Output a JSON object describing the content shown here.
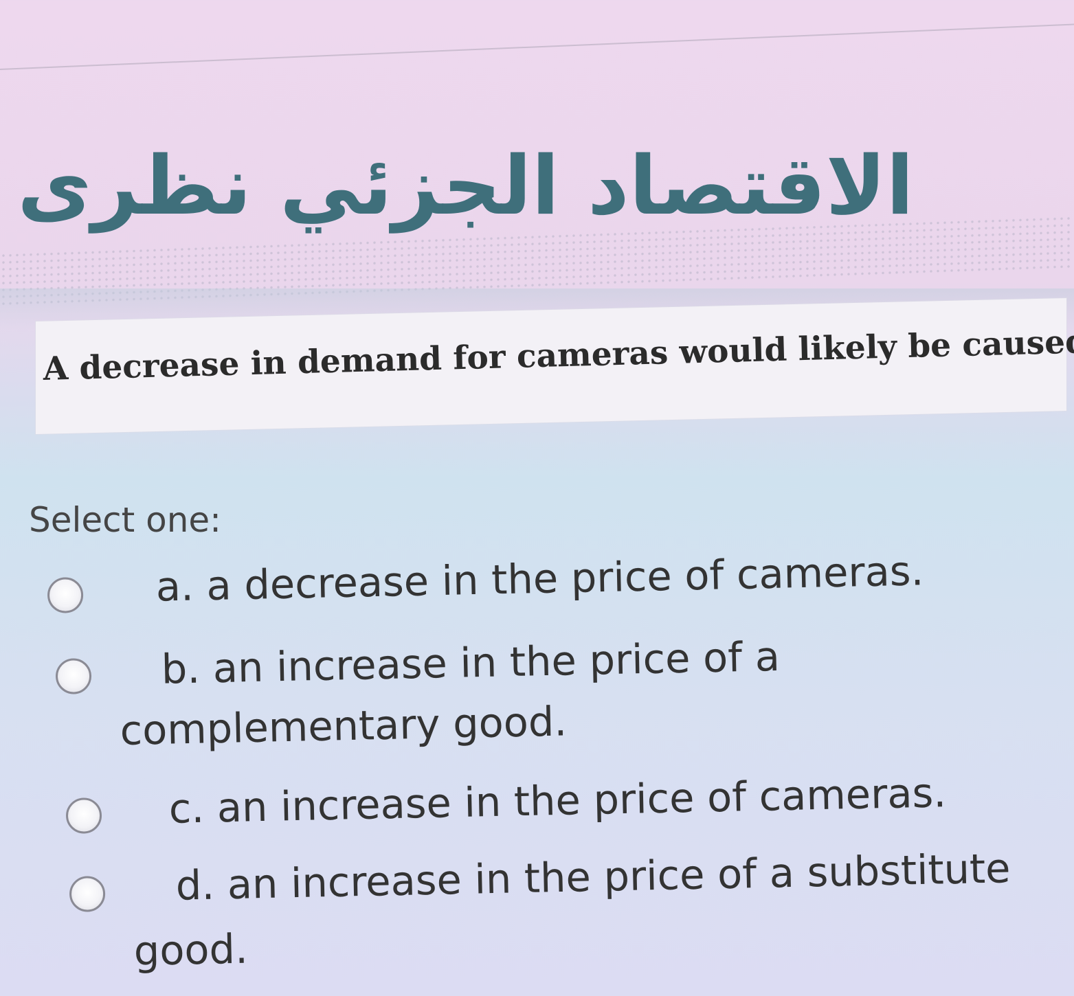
{
  "header": {
    "title": "الاقتصاد الجزئي نظرى"
  },
  "question": {
    "text": "A decrease in demand for cameras would likely be caused by",
    "select_label": "Select one:"
  },
  "options": [
    {
      "line1": "a. a decrease in the price of cameras.",
      "line2": "",
      "selected": false
    },
    {
      "line1": "b. an increase in the price of a",
      "line2": "complementary good.",
      "selected": false
    },
    {
      "line1": "c. an increase in the price of cameras.",
      "line2": "",
      "selected": false
    },
    {
      "line1": "d. an increase in the price of a substitute",
      "line2": "good.",
      "selected": false
    }
  ],
  "colors": {
    "header_text": "#3f6f7b",
    "question_box": "#f3f1f6",
    "body_text": "#333333"
  }
}
